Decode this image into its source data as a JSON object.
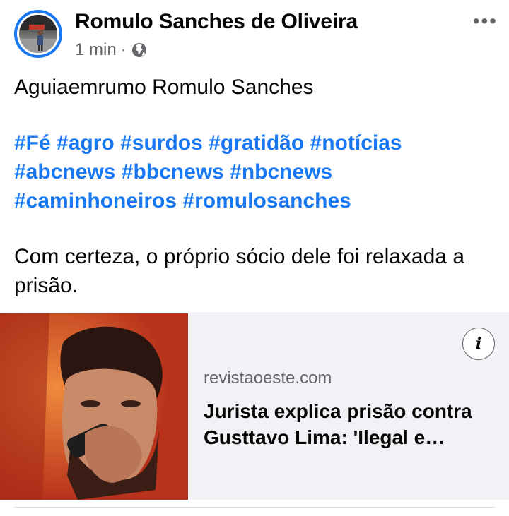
{
  "post": {
    "author": "Romulo Sanches de Oliveira",
    "time": "1 min",
    "separator": "·",
    "privacy_icon": "globe-icon",
    "more_icon": "more-horizontal-icon",
    "more_label": "•••",
    "text_line1": "Aguiaemrumo Romulo Sanches",
    "hashtags": [
      "#Fé",
      "#agro",
      "#surdos",
      "#gratidão",
      "#notícias",
      "#abcnews",
      "#bbcnews",
      "#nbcnews",
      "#caminhoneiros",
      "#romulosanches"
    ],
    "text_body": "Com certeza, o próprio sócio dele foi relaxada a prisão."
  },
  "link_preview": {
    "domain": "revistaoeste.com",
    "headline": "Jurista explica prisão contra Gusttavo Lima: 'Ilegal e midiática'",
    "info_label": "i",
    "info_icon": "info-icon"
  },
  "colors": {
    "accent": "#1877f2",
    "secondary_text": "#65676b",
    "card_bg": "#f0f2f5"
  }
}
